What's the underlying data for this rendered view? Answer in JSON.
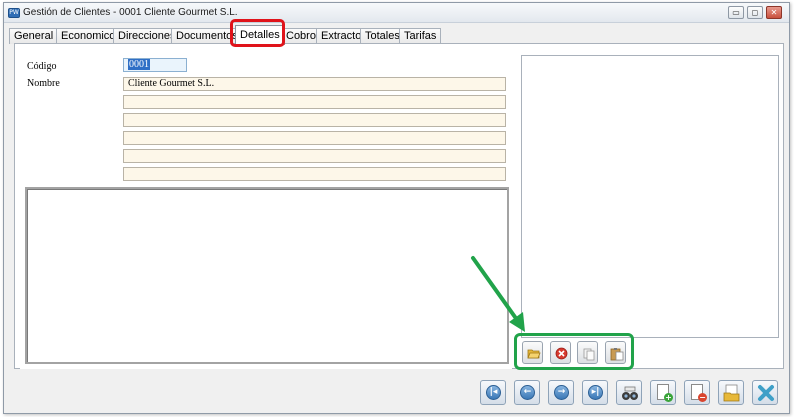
{
  "window": {
    "title": "Gestión de Clientes - 0001 Cliente Gourmet S.L.",
    "app_icon_text": "PW"
  },
  "tabs": [
    {
      "label": "General",
      "active": false
    },
    {
      "label": "Economico",
      "active": false
    },
    {
      "label": "Direcciones",
      "active": false
    },
    {
      "label": "Documentos",
      "active": false
    },
    {
      "label": "Detalles",
      "active": true
    },
    {
      "label": "Cobros",
      "active": false
    },
    {
      "label": "Extracto",
      "active": false
    },
    {
      "label": "Totales",
      "active": false
    },
    {
      "label": "Tarifas",
      "active": false
    }
  ],
  "form": {
    "codigo_label": "Código",
    "codigo_value": "0001",
    "nombre_label": "Nombre",
    "nombre_value": "Cliente Gourmet S.L.",
    "extra_lines": [
      "",
      "",
      "",
      "",
      ""
    ]
  },
  "image_toolbar": [
    "open-folder-icon",
    "delete-icon",
    "copy-icon",
    "paste-icon"
  ],
  "nav_toolbar": [
    "first-record-icon",
    "previous-record-icon",
    "next-record-icon",
    "last-record-icon",
    "search-binoculars-icon",
    "new-record-icon",
    "delete-record-icon",
    "open-record-icon",
    "close-icon"
  ],
  "annotation_colors": {
    "tab_highlight": "#e0131a",
    "toolbar_highlight": "#21a34a"
  }
}
